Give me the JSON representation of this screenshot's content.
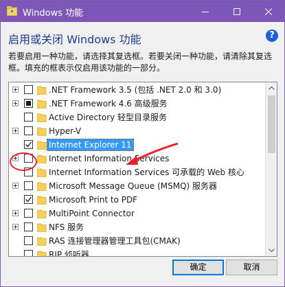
{
  "window": {
    "title": "Windows 功能",
    "accent": "#7e56b8"
  },
  "heading": "启用或关闭 Windows 功能",
  "description": "若要启用一种功能，请选择其复选框。若要关闭一种功能，请清除其复选框。填充的框表示仅启用该功能的一部分。",
  "features": [
    {
      "label": ".NET Framework 3.5 (包括 .NET 2.0 和 3.0)",
      "expandable": true,
      "state": "unchecked"
    },
    {
      "label": ".NET Framework 4.6 高级服务",
      "expandable": true,
      "state": "partial"
    },
    {
      "label": "Active Directory 轻型目录服务",
      "expandable": false,
      "state": "unchecked"
    },
    {
      "label": "Hyper-V",
      "expandable": true,
      "state": "unchecked"
    },
    {
      "label": "Internet Explorer 11",
      "expandable": false,
      "state": "checked",
      "selected": true
    },
    {
      "label": "Internet Information Services",
      "expandable": true,
      "state": "unchecked"
    },
    {
      "label": "Internet Information Services 可承载的 Web 核心",
      "expandable": false,
      "state": "unchecked"
    },
    {
      "label": "Microsoft Message Queue (MSMQ) 服务器",
      "expandable": true,
      "state": "unchecked"
    },
    {
      "label": "Microsoft Print to PDF",
      "expandable": false,
      "state": "checked"
    },
    {
      "label": "MultiPoint Connector",
      "expandable": true,
      "state": "unchecked"
    },
    {
      "label": "NFS 服务",
      "expandable": true,
      "state": "unchecked"
    },
    {
      "label": "RAS 连接管理器管理工具包(CMAK)",
      "expandable": false,
      "state": "unchecked"
    },
    {
      "label": "RIP 侦听器",
      "expandable": false,
      "state": "unchecked"
    }
  ],
  "buttons": {
    "ok": "确定",
    "cancel": "取消"
  },
  "annotation_color": "#e8232a"
}
